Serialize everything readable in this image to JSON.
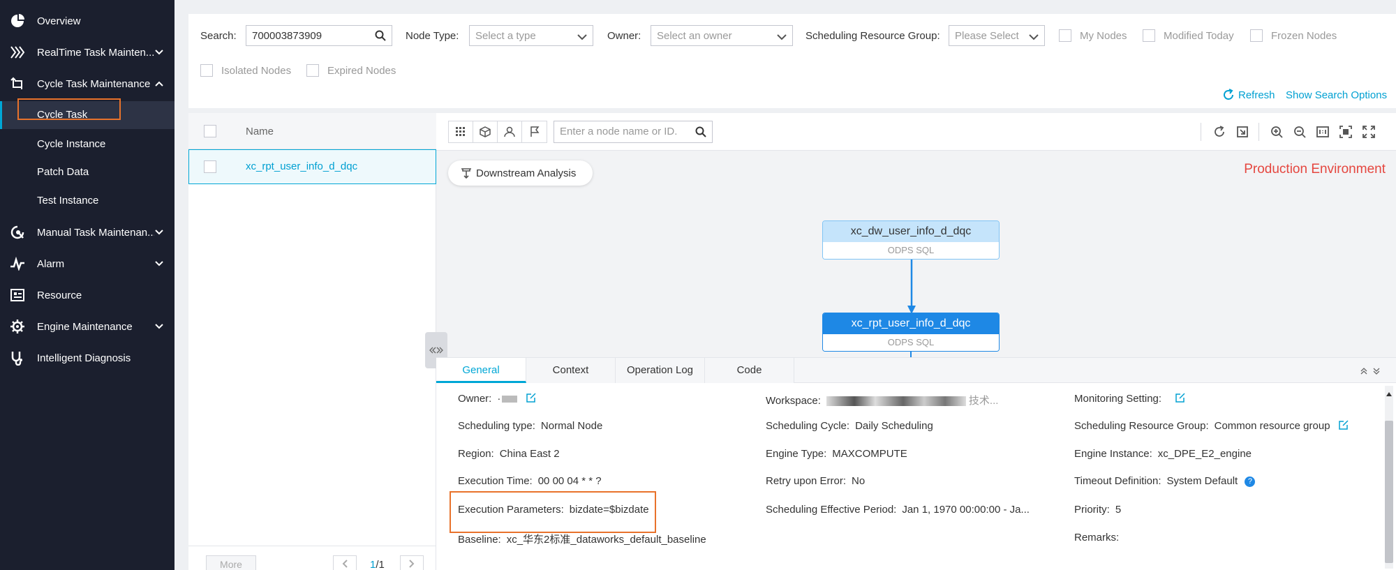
{
  "sidebar": {
    "items": [
      {
        "label": "Overview",
        "icon": "pie-chart-icon"
      },
      {
        "label": "RealTime Task Mainten...",
        "icon": "realtime-icon",
        "chevron": "down"
      },
      {
        "label": "Cycle Task Maintenance",
        "icon": "cycle-icon",
        "chevron": "up"
      },
      {
        "label": "Manual Task Maintenan...",
        "icon": "manual-icon",
        "chevron": "down"
      },
      {
        "label": "Alarm",
        "icon": "pulse-icon",
        "chevron": "down"
      },
      {
        "label": "Resource",
        "icon": "resource-icon"
      },
      {
        "label": "Engine Maintenance",
        "icon": "gear-icon",
        "chevron": "down"
      },
      {
        "label": "Intelligent Diagnosis",
        "icon": "stethoscope-icon"
      }
    ],
    "sub_items": [
      {
        "label": "Cycle Task"
      },
      {
        "label": "Cycle Instance"
      },
      {
        "label": "Patch Data"
      },
      {
        "label": "Test Instance"
      }
    ]
  },
  "search": {
    "label": "Search:",
    "value": "700003873909",
    "node_type_label": "Node Type:",
    "node_type_placeholder": "Select a type",
    "owner_label": "Owner:",
    "owner_placeholder": "Select an owner",
    "resource_group_label": "Scheduling Resource Group:",
    "resource_group_placeholder": "Please Select",
    "checkboxes": [
      "My Nodes",
      "Modified Today",
      "Frozen Nodes",
      "Isolated Nodes",
      "Expired Nodes"
    ],
    "refresh": "Refresh",
    "show_options": "Show Search Options"
  },
  "node_list": {
    "header": "Name",
    "rows": [
      "xc_rpt_user_info_d_dqc"
    ],
    "more": "More",
    "page_current": "1",
    "page_total": "/1"
  },
  "canvas": {
    "search_placeholder": "Enter a node name or ID.",
    "downstream": "Downstream Analysis",
    "environment": "Production Environment",
    "nodes": [
      {
        "name": "xc_dw_user_info_d_dqc",
        "type": "ODPS SQL"
      },
      {
        "name": "xc_rpt_user_info_d_dqc",
        "type": "ODPS SQL"
      }
    ]
  },
  "detail": {
    "tabs": [
      "General",
      "Context",
      "Operation Log",
      "Code"
    ],
    "fields": {
      "owner": {
        "k": "Owner:",
        "v": "·"
      },
      "workspace": {
        "k": "Workspace:",
        "v": "技术..."
      },
      "monitoring": {
        "k": "Monitoring Setting:",
        "v": ""
      },
      "scheduling_type": {
        "k": "Scheduling type:",
        "v": "Normal Node"
      },
      "scheduling_cycle": {
        "k": "Scheduling Cycle:",
        "v": "Daily Scheduling"
      },
      "resource_group": {
        "k": "Scheduling Resource Group:",
        "v": "Common resource group"
      },
      "region": {
        "k": "Region:",
        "v": "China East 2"
      },
      "engine_type": {
        "k": "Engine Type:",
        "v": "MAXCOMPUTE"
      },
      "engine_instance": {
        "k": "Engine Instance:",
        "v": "xc_DPE_E2_engine"
      },
      "execution_time": {
        "k": "Execution Time:",
        "v": "00 00 04 * * ?"
      },
      "retry": {
        "k": "Retry upon Error:",
        "v": "No"
      },
      "timeout": {
        "k": "Timeout Definition:",
        "v": "System Default"
      },
      "exec_params": {
        "k": "Execution Parameters:",
        "v": "bizdate=$bizdate"
      },
      "effective_period": {
        "k": "Scheduling Effective Period:",
        "v": "Jan 1, 1970 00:00:00 - Ja..."
      },
      "priority": {
        "k": "Priority:",
        "v": "5"
      },
      "baseline": {
        "k": "Baseline:",
        "v": "xc_华东2标准_dataworks_default_baseline"
      },
      "remarks": {
        "k": "Remarks:",
        "v": ""
      }
    }
  },
  "colors": {
    "accent": "#00a7d6",
    "highlight": "#e8722b",
    "env": "#e5463f"
  }
}
